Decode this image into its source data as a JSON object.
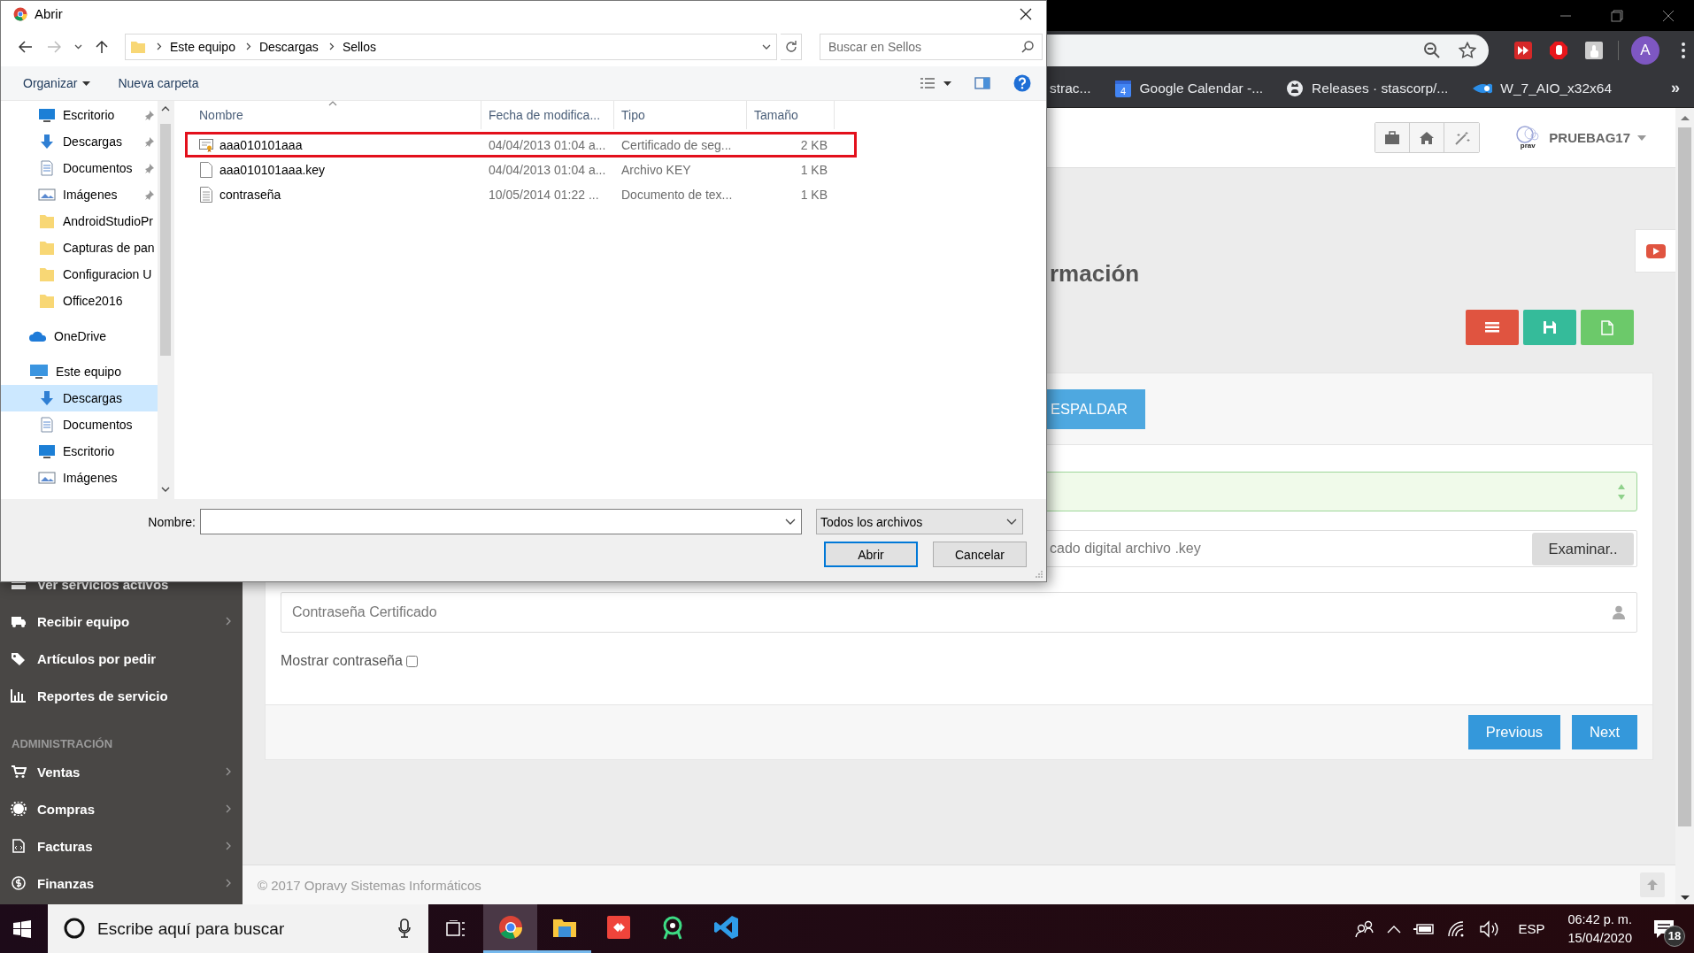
{
  "browser": {
    "bookmarks": [
      {
        "label": "strac..."
      },
      {
        "label": "Google Calendar -...",
        "icon_text": "4"
      },
      {
        "label": "Releases · stascorp/..."
      },
      {
        "label": "W_7_AIO_x32x64"
      }
    ],
    "more": "»",
    "profile": "A"
  },
  "page": {
    "user": "PRUEBAG17",
    "logo_text": "prav",
    "title": "rmación",
    "actions": [
      {
        "kind": "list",
        "color": "#e05440"
      },
      {
        "kind": "save",
        "color": "#35bb9a"
      },
      {
        "kind": "file",
        "color": "#6cc96a"
      }
    ],
    "tab_button": "ESPALDAR",
    "key_field": {
      "placeholder": "cado digital archivo .key"
    },
    "browse_button": "Examinar..",
    "password_field": {
      "placeholder": "Contraseña Certificado"
    },
    "show_password": {
      "label": "Mostrar contraseña",
      "checked": false
    },
    "wizard_buttons": [
      "Previous",
      "Next"
    ],
    "footer": "© 2017 Opravy Sistemas Informáticos"
  },
  "sidebar": {
    "items": [
      {
        "kind": "link",
        "label": "Ver servicios activos",
        "expandable": false
      },
      {
        "kind": "link",
        "label": "Recibir equipo",
        "expandable": true
      },
      {
        "kind": "link",
        "label": "Artículos por pedir",
        "expandable": false
      },
      {
        "kind": "link",
        "label": "Reportes de servicio",
        "expandable": false
      },
      {
        "kind": "section",
        "label": "ADMINISTRACIÓN"
      },
      {
        "kind": "link",
        "label": "Ventas",
        "expandable": true
      },
      {
        "kind": "link",
        "label": "Compras",
        "expandable": true
      },
      {
        "kind": "link",
        "label": "Facturas",
        "expandable": true
      },
      {
        "kind": "link",
        "label": "Finanzas",
        "expandable": true
      }
    ]
  },
  "dialog": {
    "title": "Abrir",
    "can_go_back": true,
    "can_go_forward": false,
    "breadcrumb": [
      "Este equipo",
      "Descargas",
      "Sellos"
    ],
    "search": {
      "placeholder": "Buscar en Sellos"
    },
    "commands": [
      {
        "label": "Organizar",
        "dropdown": true
      },
      {
        "label": "Nueva carpeta",
        "dropdown": false
      }
    ],
    "quick_access": [
      {
        "label": "Escritorio",
        "pinned": true,
        "selected": false
      },
      {
        "label": "Descargas",
        "pinned": true,
        "selected": false
      },
      {
        "label": "Documentos",
        "pinned": true,
        "selected": false
      },
      {
        "label": "Imágenes",
        "pinned": true,
        "selected": false
      },
      {
        "label": "AndroidStudioPr",
        "pinned": false,
        "selected": false
      },
      {
        "label": "Capturas de pan",
        "pinned": false,
        "selected": false
      },
      {
        "label": "Configuracion U",
        "pinned": false,
        "selected": false
      },
      {
        "label": "Office2016",
        "pinned": false,
        "selected": false
      }
    ],
    "tree": [
      {
        "label": "OneDrive",
        "selected": false
      },
      {
        "label": "Este equipo",
        "selected": false,
        "children": [
          {
            "label": "Descargas",
            "selected": true
          },
          {
            "label": "Documentos",
            "selected": false
          },
          {
            "label": "Escritorio",
            "selected": false
          },
          {
            "label": "Imágenes",
            "selected": false
          }
        ]
      }
    ],
    "columns": [
      {
        "label": "Nombre",
        "sorted": true
      },
      {
        "label": "Fecha de modifica...",
        "sorted": false
      },
      {
        "label": "Tipo",
        "sorted": false
      },
      {
        "label": "Tamaño",
        "sorted": false
      }
    ],
    "rows": [
      {
        "name": "aaa010101aaa",
        "date": "04/04/2013 01:04 a...",
        "type": "Certificado de seg...",
        "size": "2 KB",
        "marked": true
      },
      {
        "name": "aaa010101aaa.key",
        "date": "04/04/2013 01:04 a...",
        "type": "Archivo KEY",
        "size": "1 KB",
        "marked": false
      },
      {
        "name": "contraseña",
        "date": "10/05/2014 01:22 ...",
        "type": "Documento de tex...",
        "size": "1 KB",
        "marked": false
      }
    ],
    "filename_label": "Nombre:",
    "filter": "Todos los archivos",
    "buttons": [
      {
        "label": "Abrir",
        "default": true
      },
      {
        "label": "Cancelar",
        "default": false
      }
    ]
  },
  "taskbar": {
    "search_placeholder": "Escribe aquí para buscar",
    "apps": [
      {
        "running": true,
        "selected": true
      },
      {
        "running": true,
        "selected": false
      },
      {
        "running": false,
        "selected": false
      },
      {
        "running": false,
        "selected": false
      },
      {
        "running": false,
        "selected": false
      }
    ],
    "language": "ESP",
    "time": "06:42 p. m.",
    "date": "15/04/2020",
    "notifications": "18"
  }
}
